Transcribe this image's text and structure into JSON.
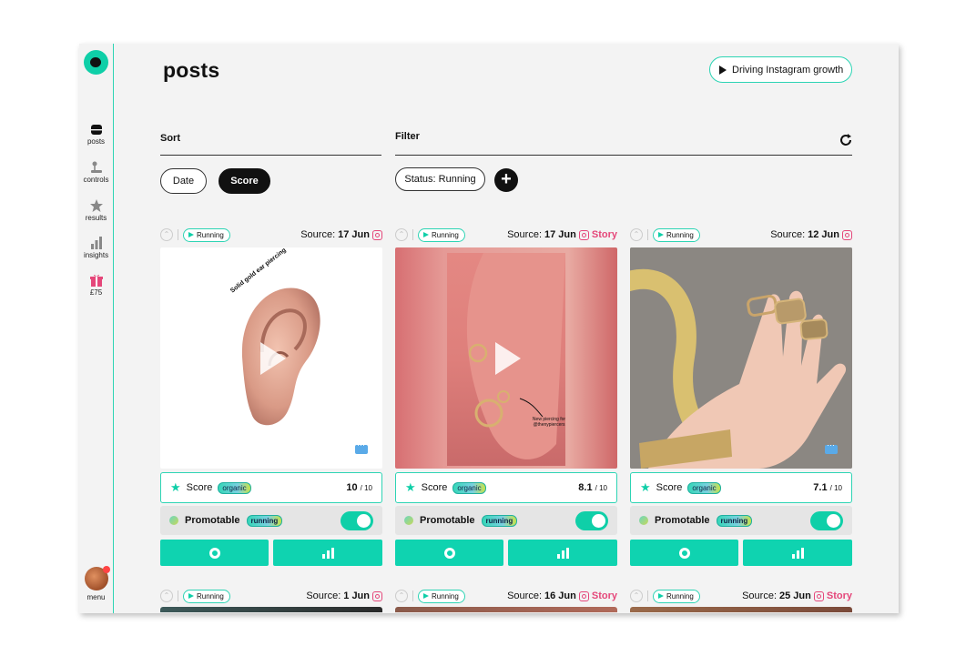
{
  "nav": {
    "items": [
      {
        "label": "posts",
        "icon": "posts-icon"
      },
      {
        "label": "controls",
        "icon": "joystick-icon"
      },
      {
        "label": "results",
        "icon": "star-icon"
      },
      {
        "label": "insights",
        "icon": "bar-chart-icon"
      },
      {
        "label": "£75",
        "icon": "gift-icon"
      }
    ],
    "menu_label": "menu"
  },
  "header": {
    "title": "posts",
    "growth_button": "Driving Instagram growth"
  },
  "sort": {
    "label": "Sort",
    "options": [
      "Date",
      "Score"
    ],
    "selected": "Score"
  },
  "filter": {
    "label": "Filter",
    "chip": "Status: Running"
  },
  "posts": [
    {
      "status": "Running",
      "source_label": "Source:",
      "date": "17 Jun",
      "story": "",
      "media_caption": "Solid gold ear piercing",
      "score_label": "Score",
      "score_tag": "organic",
      "score": "10",
      "score_max": "/ 10",
      "promo_label": "Promotable",
      "promo_tag": "running"
    },
    {
      "status": "Running",
      "source_label": "Source:",
      "date": "17 Jun",
      "story": "Story",
      "media_caption": "New piercing for @thenypiercers",
      "score_label": "Score",
      "score_tag": "organic",
      "score": "8.1",
      "score_max": "/ 10",
      "promo_label": "Promotable",
      "promo_tag": "running"
    },
    {
      "status": "Running",
      "source_label": "Source:",
      "date": "12 Jun",
      "story": "",
      "media_caption": "",
      "score_label": "Score",
      "score_tag": "organic",
      "score": "7.1",
      "score_max": "/ 10",
      "promo_label": "Promotable",
      "promo_tag": "running"
    }
  ],
  "next_row": [
    {
      "status": "Running",
      "source_label": "Source:",
      "date": "1 Jun",
      "story": ""
    },
    {
      "status": "Running",
      "source_label": "Source:",
      "date": "16 Jun",
      "story": "Story"
    },
    {
      "status": "Running",
      "source_label": "Source:",
      "date": "25 Jun",
      "story": "Story"
    }
  ],
  "colors": {
    "accent": "#0fd3b0",
    "instagram": "#e5477a",
    "background": "#f3f3f3"
  }
}
